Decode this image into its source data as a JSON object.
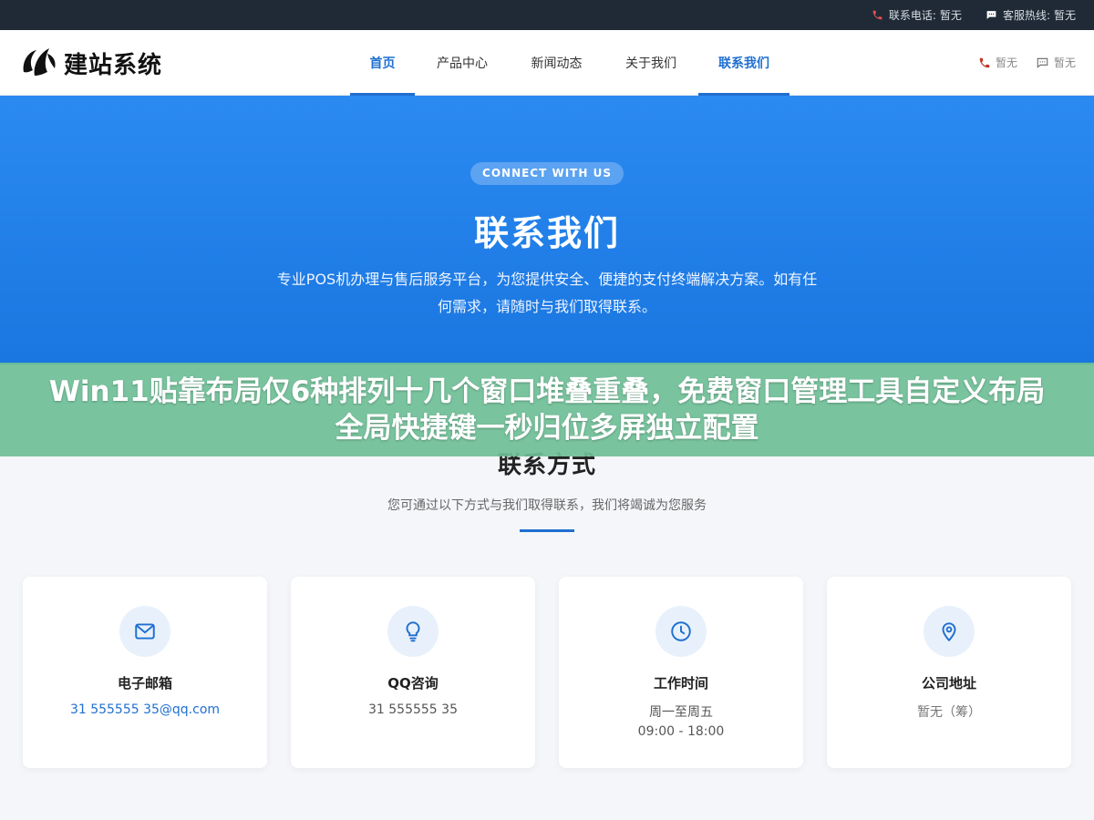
{
  "topbar": {
    "phone_label": "联系电话:",
    "phone_value": "暂无",
    "service_label": "客服热线:",
    "service_value": "暂无"
  },
  "header": {
    "logo_text": "建站系统",
    "nav": [
      {
        "label": "首页",
        "active": true
      },
      {
        "label": "产品中心",
        "active": false
      },
      {
        "label": "新闻动态",
        "active": false
      },
      {
        "label": "关于我们",
        "active": false
      },
      {
        "label": "联系我们",
        "active": true
      }
    ],
    "right_phone": "暂无",
    "right_chat": "暂无"
  },
  "hero": {
    "badge": "CONNECT WITH US",
    "title": "联系我们",
    "desc": "专业POS机办理与售后服务平台，为您提供安全、便捷的支付终端解决方案。如有任何需求，请随时与我们取得联系。"
  },
  "overlay": {
    "text": "Win11贴靠布局仅6种排列十几个窗口堆叠重叠，免费窗口管理工具自定义布局全局快捷键一秒归位多屏独立配置"
  },
  "section": {
    "title": "联系方式",
    "desc": "您可通过以下方式与我们取得联系，我们将竭诚为您服务"
  },
  "cards": [
    {
      "icon": "mail-icon",
      "title": "电子邮箱",
      "line1": "31 555555 35@qq.com",
      "line2": ""
    },
    {
      "icon": "lightbulb-icon",
      "title": "QQ咨询",
      "line1": "31 555555 35",
      "line2": ""
    },
    {
      "icon": "clock-icon",
      "title": "工作时间",
      "line1": "周一至周五",
      "line2": "09:00 - 18:00"
    },
    {
      "icon": "location-pin-icon",
      "title": "公司地址",
      "line1": "暂无（筹）",
      "line2": ""
    }
  ],
  "colors": {
    "accent": "#1f6fd0",
    "hero": "#2b8af2",
    "overlay": "#6ebe96",
    "topbar": "#1f2a36"
  }
}
